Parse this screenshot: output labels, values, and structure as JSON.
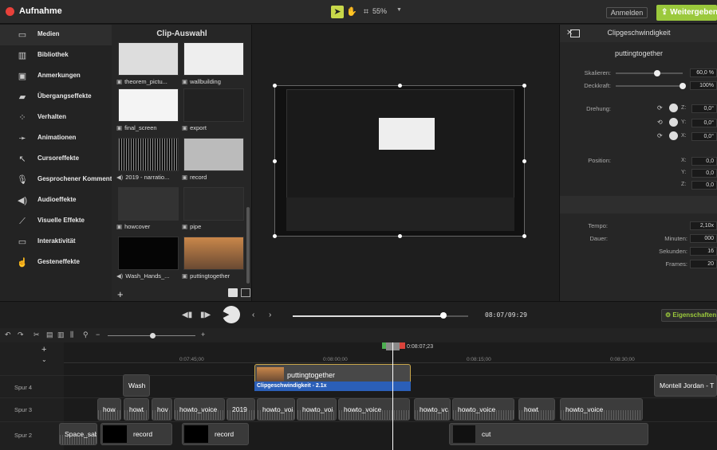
{
  "app": {
    "title": "Aufnahme"
  },
  "toolbar": {
    "zoom": "55%",
    "login": "Anmelden",
    "share": "Weitergeben"
  },
  "sidebar": {
    "items": [
      {
        "label": "Medien",
        "icon": "film-icon"
      },
      {
        "label": "Bibliothek",
        "icon": "library-icon"
      },
      {
        "label": "Anmerkungen",
        "icon": "annotation-icon"
      },
      {
        "label": "Übergangseffekte",
        "icon": "transition-icon"
      },
      {
        "label": "Verhalten",
        "icon": "behavior-icon"
      },
      {
        "label": "Animationen",
        "icon": "animation-icon"
      },
      {
        "label": "Cursoreffekte",
        "icon": "cursor-icon"
      },
      {
        "label": "Gesprochener Kommentar",
        "icon": "microphone-icon"
      },
      {
        "label": "Audioeffekte",
        "icon": "speaker-icon"
      },
      {
        "label": "Visuelle Effekte",
        "icon": "wand-icon"
      },
      {
        "label": "Interaktivität",
        "icon": "interactive-icon"
      },
      {
        "label": "Gesteneffekte",
        "icon": "gesture-icon"
      }
    ]
  },
  "clips": {
    "title": "Clip-Auswahl",
    "items": [
      {
        "label": "theorem_pictu...",
        "type": "image"
      },
      {
        "label": "wallbuilding",
        "type": "image"
      },
      {
        "label": "final_screen",
        "type": "image"
      },
      {
        "label": "export",
        "type": "image"
      },
      {
        "label": "2019 - narratio...",
        "type": "audio"
      },
      {
        "label": "record",
        "type": "image"
      },
      {
        "label": "howcover",
        "type": "image"
      },
      {
        "label": "pipe",
        "type": "image"
      },
      {
        "label": "Wash_Hands_...",
        "type": "audio"
      },
      {
        "label": "puttingtogether",
        "type": "image"
      }
    ]
  },
  "props": {
    "title": "puttingtogether",
    "scale_label": "Skalieren:",
    "scale_value": "60,0 %",
    "opacity_label": "Deckkraft:",
    "opacity_value": "100%",
    "rotation_label": "Drehung:",
    "rot_z": "0,0°",
    "rot_y": "0,0°",
    "rot_x": "0,0°",
    "position_label": "Position:",
    "pos_x": "0,0",
    "pos_y": "0,0",
    "pos_z": "0,0",
    "speed_title": "Clipgeschwindigkeit",
    "tempo_label": "Tempo:",
    "tempo_value": "2,10x",
    "duration_label": "Dauer:",
    "minutes_label": "Minuten:",
    "minutes_value": "000",
    "seconds_label": "Sekunden:",
    "seconds_value": "16",
    "frames_label": "Frames:",
    "frames_value": "20",
    "axis_z": "Z:",
    "axis_y": "Y:",
    "axis_x": "X:",
    "scale_fraction": 0.6,
    "opacity_fraction": 1.0
  },
  "player": {
    "time": "08:07/09:29",
    "properties_btn": "Eigenschaften",
    "progress": 0.86
  },
  "timeline": {
    "playhead_time": "0:08:07;23",
    "ticks": [
      "0:07:45;00",
      "0:08:00;00",
      "0:08:15;00",
      "0:08:30;00"
    ],
    "tracks": [
      {
        "name": "Spur 4",
        "clips": [
          "Wash",
          "puttingtogether",
          "Montell Jordan - T"
        ]
      },
      {
        "name": "Spur 3",
        "clips": [
          "how",
          "howt",
          "hov",
          "howto_voice",
          "2019",
          "howto_voi",
          "howto_voi",
          "howto_voice",
          "howto_vc",
          "howto_voice",
          "howt",
          "howto_voice"
        ]
      },
      {
        "name": "Spur 2",
        "clips": [
          "Space_sab",
          "record",
          "record",
          "cut"
        ]
      }
    ],
    "speed_badge": "Clipgeschwindigkeit - 2.1x"
  }
}
